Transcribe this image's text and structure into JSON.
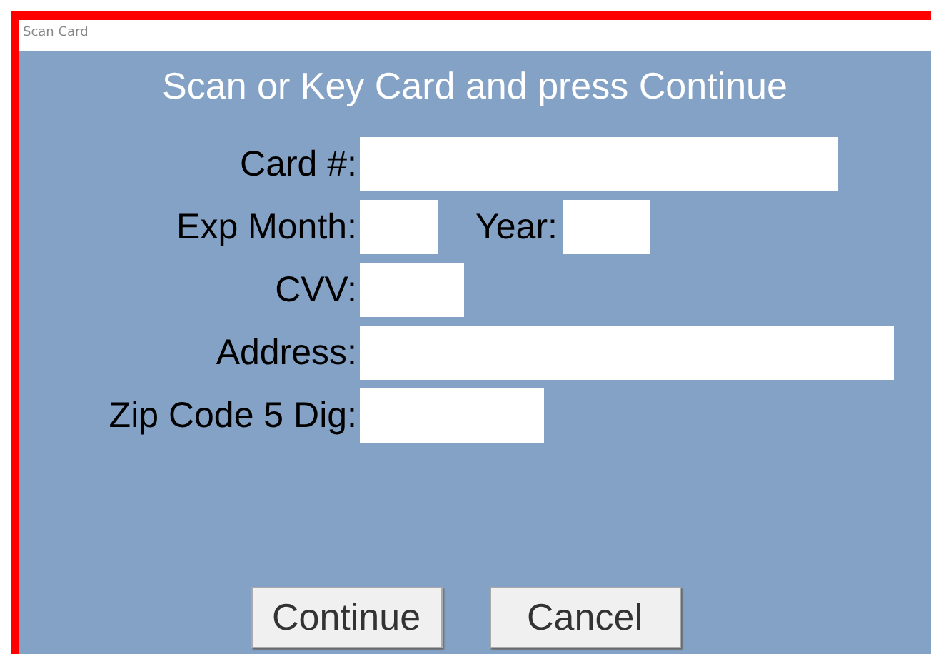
{
  "window": {
    "title": "Scan Card"
  },
  "heading": "Scan or Key Card and press Continue",
  "rows": [
    {
      "fields": [
        {
          "label": "Card #:"
        }
      ]
    },
    {
      "fields": [
        {
          "label": "Exp Month:"
        },
        {
          "label": "Year:"
        }
      ]
    },
    {
      "fields": [
        {
          "label": "CVV:"
        }
      ]
    },
    {
      "fields": [
        {
          "label": "Address:"
        }
      ]
    },
    {
      "fields": [
        {
          "label": "Zip Code 5 Dig:"
        }
      ]
    }
  ],
  "buttons": [
    "Continue",
    "Cancel"
  ]
}
